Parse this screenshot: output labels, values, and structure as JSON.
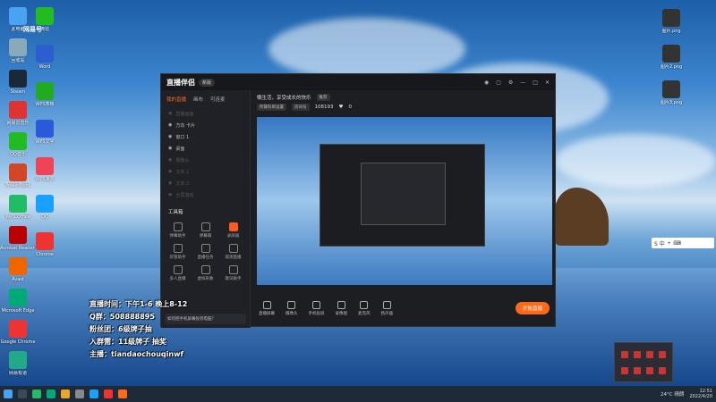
{
  "desktop": {
    "icons_left": [
      {
        "label": "此电脑",
        "color": "#4aa3f0"
      },
      {
        "label": "回收站",
        "color": "#8ab"
      },
      {
        "label": "Steam",
        "color": "#1b2838"
      },
      {
        "label": "网易云音乐",
        "color": "#d33"
      },
      {
        "label": "QQ音乐",
        "color": "#2b2"
      },
      {
        "label": "PowerPoint",
        "color": "#d24726"
      },
      {
        "label": "WPS Office",
        "color": "#2b6"
      },
      {
        "label": "Acrobat Reader DC",
        "color": "#b00"
      },
      {
        "label": "Avast",
        "color": "#e60"
      },
      {
        "label": "Microsoft Edge",
        "color": "#0a7"
      },
      {
        "label": "Google Chrome",
        "color": "#e33"
      },
      {
        "label": "网易有道",
        "color": "#2a8"
      }
    ],
    "icons_col2": [
      {
        "label": "微信",
        "color": "#2b2"
      },
      {
        "label": "Word",
        "color": "#2b5fcf"
      },
      {
        "label": "WPS表格",
        "color": "#2a2"
      },
      {
        "label": "WPS文字",
        "color": "#2a5ad9"
      },
      {
        "label": "WPS演示",
        "color": "#e45"
      },
      {
        "label": "QQ",
        "color": "#1aa0ff"
      },
      {
        "label": "Chrome",
        "color": "#e33"
      }
    ],
    "icons_right": [
      {
        "label": "图片.png",
        "color": "#333"
      },
      {
        "label": "图片2.png",
        "color": "#333"
      },
      {
        "label": "图片3.png",
        "color": "#333"
      }
    ],
    "top_label": "网易号"
  },
  "app": {
    "logo": "直播伴侣",
    "version": "新版",
    "tabs": [
      "我的直播",
      "画布",
      "可连麦"
    ],
    "sources": [
      {
        "label": "直播画面",
        "on": false
      },
      {
        "label": "方向 卡片",
        "on": true
      },
      {
        "label": "窗口 1",
        "on": true
      },
      {
        "label": "桌面",
        "on": true
      },
      {
        "label": "摄像头",
        "on": false
      },
      {
        "label": "文本 1",
        "on": false
      },
      {
        "label": "文本 2",
        "on": false
      },
      {
        "label": "全屏游戏",
        "on": false
      }
    ],
    "tools_header": "工具箱",
    "tools": [
      {
        "label": "弹幕助手",
        "hot": false
      },
      {
        "label": "弹幕箱",
        "hot": false
      },
      {
        "label": "录屏器",
        "hot": true
      },
      {
        "label": "房管助手",
        "hot": false
      },
      {
        "label": "直播任务",
        "hot": false
      },
      {
        "label": "观测直播",
        "hot": false
      },
      {
        "label": "多人直播",
        "hot": false
      },
      {
        "label": "虚拟形象",
        "hot": false
      },
      {
        "label": "歌词助手",
        "hot": false
      }
    ],
    "tip": "如何把手机屏幕投到电脑？",
    "room_title": "懒生活，享受成长的快乐",
    "room_tag": "推荐",
    "chip1": "所属科目设置",
    "chip2": "房间号",
    "room_id": "108193",
    "likes": "0",
    "controls": [
      "直播屏幕",
      "摄像头",
      "手机投屏",
      "录像图",
      "麦克风",
      "扬声器"
    ],
    "start_button": "开始直播"
  },
  "overlay": {
    "lines": [
      "直播时间：下午1-6 晚上8-12",
      "Q群：508888895",
      "粉丝团：6级牌子抽",
      "入群需：11级牌子 抽奖",
      "主播：tiandaochouqinwf"
    ]
  },
  "taskbar": {
    "weather": "24°C 晴朗",
    "time": "12:51",
    "date": "2022/4/20"
  },
  "ime": {
    "label": "S 中"
  }
}
